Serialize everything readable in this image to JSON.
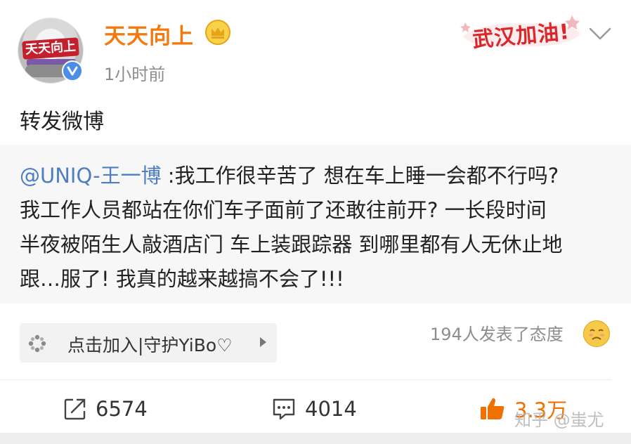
{
  "post": {
    "username": "天天向上",
    "time": "1小时前",
    "badge": "武汉加油!",
    "text": "转发微博",
    "avatar_label": "天天向上"
  },
  "repost": {
    "mention": "@UNIQ-王一博",
    "text": " :我工作很辛苦了 想在车上睡一会都不行吗?\n我工作人员都站在你们车子面前了还敢往前开? 一长段时间\n半夜被陌生人敲酒店门 车上装跟踪器 到哪里都有人无休止地\n跟…服了! 我真的越来越搞不会了!!!"
  },
  "topic": {
    "label": "点击加入|守护YiBo♡"
  },
  "reactions": {
    "text": "194人发表了态度"
  },
  "actions": {
    "repost_count": "6574",
    "comment_count": "4014",
    "like_count": "3.3万"
  },
  "watermark": "知乎 @蚩尤",
  "colors": {
    "username": "#f47a0d",
    "mention": "#4d7fbf",
    "like": "#f07000",
    "badge": "#d9272c"
  },
  "icons": [
    "verified-icon",
    "crown-icon",
    "chevron-down-icon",
    "topic-icon",
    "repost-icon",
    "comment-icon",
    "like-icon",
    "emoji-icon"
  ]
}
